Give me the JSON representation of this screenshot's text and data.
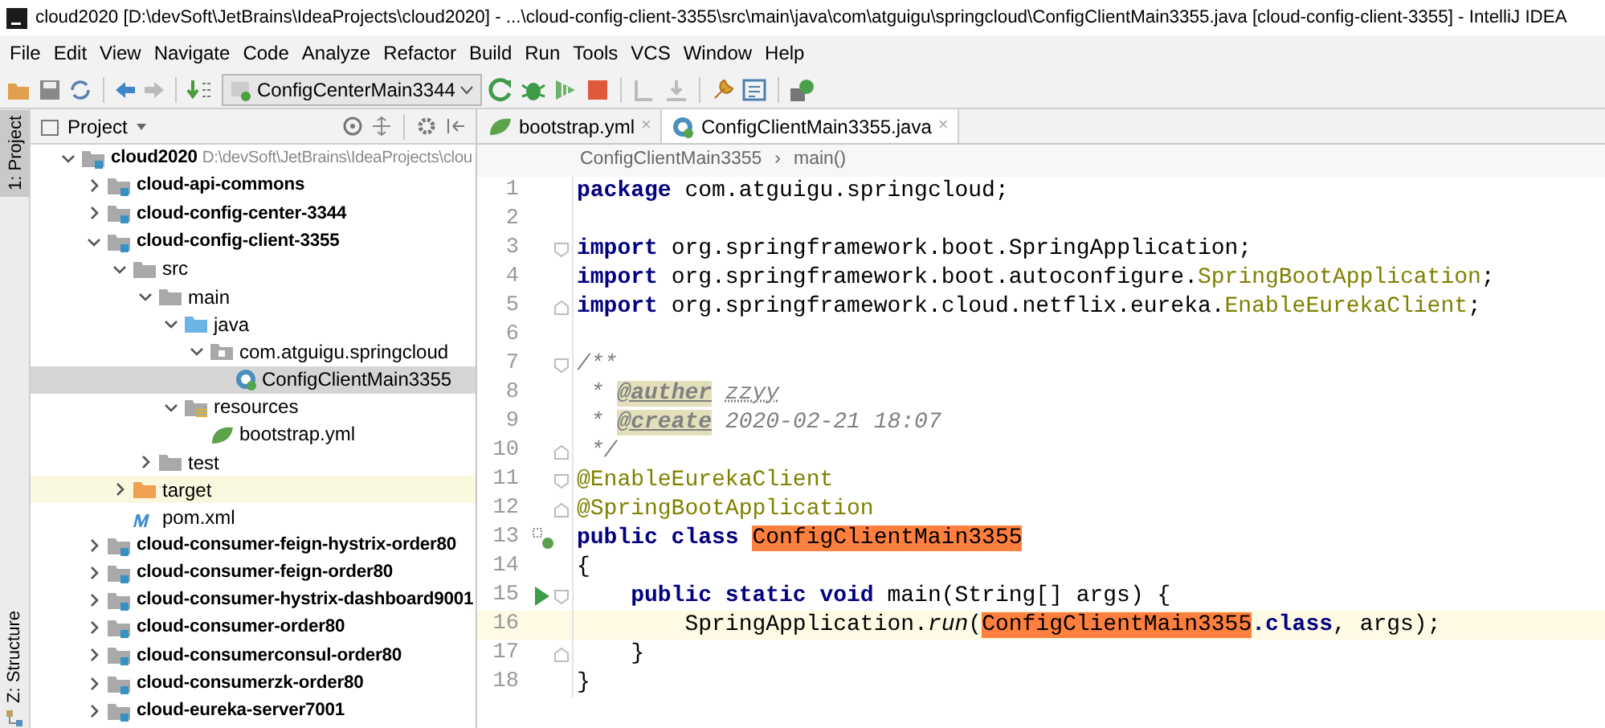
{
  "window": {
    "title": "cloud2020 [D:\\devSoft\\JetBrains\\IdeaProjects\\cloud2020] - ...\\cloud-config-client-3355\\src\\main\\java\\com\\atguigu\\springcloud\\ConfigClientMain3355.java [cloud-config-client-3355] - IntelliJ IDEA"
  },
  "menu": [
    "File",
    "Edit",
    "View",
    "Navigate",
    "Code",
    "Analyze",
    "Refactor",
    "Build",
    "Run",
    "Tools",
    "VCS",
    "Window",
    "Help"
  ],
  "toolbar": {
    "run_config": "ConfigCenterMain3344"
  },
  "side_strip": {
    "top": "1: Project",
    "bottom": "Z: Structure"
  },
  "project": {
    "title": "Project",
    "tree": [
      {
        "label": "cloud2020",
        "path": "D:\\devSoft\\JetBrains\\IdeaProjects\\clou",
        "kind": "module",
        "expanded": true,
        "selected": false,
        "highlighted": false,
        "children": [
          {
            "label": "cloud-api-commons",
            "kind": "module",
            "expanded": false,
            "selected": false,
            "highlighted": false
          },
          {
            "label": "cloud-config-center-3344",
            "kind": "module",
            "expanded": false,
            "selected": false,
            "highlighted": false
          },
          {
            "label": "cloud-config-client-3355",
            "kind": "module",
            "expanded": true,
            "selected": false,
            "highlighted": false,
            "children": [
              {
                "label": "src",
                "kind": "folder",
                "expanded": true,
                "selected": false,
                "highlighted": false,
                "children": [
                  {
                    "label": "main",
                    "kind": "folder",
                    "expanded": true,
                    "selected": false,
                    "highlighted": false,
                    "children": [
                      {
                        "label": "java",
                        "kind": "source",
                        "expanded": true,
                        "selected": false,
                        "highlighted": false,
                        "children": [
                          {
                            "label": "com.atguigu.springcloud",
                            "kind": "package",
                            "expanded": true,
                            "selected": false,
                            "highlighted": false,
                            "children": [
                              {
                                "label": "ConfigClientMain3355",
                                "kind": "class",
                                "selected": true,
                                "highlighted": false
                              }
                            ]
                          }
                        ]
                      },
                      {
                        "label": "resources",
                        "kind": "resources",
                        "expanded": true,
                        "selected": false,
                        "highlighted": false,
                        "children": [
                          {
                            "label": "bootstrap.yml",
                            "kind": "yml",
                            "selected": false,
                            "highlighted": false
                          }
                        ]
                      }
                    ]
                  },
                  {
                    "label": "test",
                    "kind": "folder",
                    "expanded": false,
                    "selected": false,
                    "highlighted": false
                  }
                ]
              },
              {
                "label": "target",
                "kind": "target",
                "expanded": false,
                "selected": false,
                "highlighted": true
              },
              {
                "label": "pom.xml",
                "kind": "maven",
                "selected": false,
                "highlighted": false
              }
            ]
          },
          {
            "label": "cloud-consumer-feign-hystrix-order80",
            "kind": "module",
            "expanded": false,
            "selected": false,
            "highlighted": false
          },
          {
            "label": "cloud-consumer-feign-order80",
            "kind": "module",
            "expanded": false,
            "selected": false,
            "highlighted": false
          },
          {
            "label": "cloud-consumer-hystrix-dashboard9001",
            "kind": "module",
            "expanded": false,
            "selected": false,
            "highlighted": false
          },
          {
            "label": "cloud-consumer-order80",
            "kind": "module",
            "expanded": false,
            "selected": false,
            "highlighted": false
          },
          {
            "label": "cloud-consumerconsul-order80",
            "kind": "module",
            "expanded": false,
            "selected": false,
            "highlighted": false
          },
          {
            "label": "cloud-consumerzk-order80",
            "kind": "module",
            "expanded": false,
            "selected": false,
            "highlighted": false
          },
          {
            "label": "cloud-eureka-server7001",
            "kind": "module",
            "expanded": false,
            "selected": false,
            "highlighted": false
          }
        ]
      }
    ]
  },
  "editor": {
    "tabs": [
      {
        "label": "bootstrap.yml",
        "kind": "yml",
        "close": "×",
        "selected": false
      },
      {
        "label": "ConfigClientMain3355.java",
        "kind": "class",
        "close": "×",
        "selected": true
      }
    ],
    "breadcrumbs": [
      "ConfigClientMain3355",
      "main()"
    ],
    "breadcrumb_separator": "›",
    "lines": [
      {
        "number": "1",
        "current": false,
        "tokens": [
          {
            "text": "package",
            "kind": "keyword"
          },
          {
            "text": " com.atguigu.springcloud;",
            "kind": "plain"
          }
        ]
      },
      {
        "number": "2",
        "current": false
      },
      {
        "number": "3",
        "current": false,
        "fold_start": true,
        "tokens": [
          {
            "text": "import",
            "kind": "keyword"
          },
          {
            "text": " org.springframework.boot.SpringApplication;",
            "kind": "plain"
          }
        ]
      },
      {
        "number": "4",
        "current": false,
        "tokens": [
          {
            "text": "import",
            "kind": "keyword"
          },
          {
            "text": " org.springframework.boot.autoconfigure.",
            "kind": "plain"
          },
          {
            "text": "SpringBootApplication",
            "kind": "annotation"
          },
          {
            "text": ";",
            "kind": "plain"
          }
        ]
      },
      {
        "number": "5",
        "current": false,
        "fold_end": true,
        "tokens": [
          {
            "text": "import",
            "kind": "keyword"
          },
          {
            "text": " org.springframework.cloud.netflix.eureka.",
            "kind": "plain"
          },
          {
            "text": "EnableEurekaClient",
            "kind": "annotation"
          },
          {
            "text": ";",
            "kind": "plain"
          }
        ]
      },
      {
        "number": "6",
        "current": false
      },
      {
        "number": "7",
        "current": false,
        "fold_start": true,
        "tokens": [
          {
            "text": "/**",
            "kind": "comment"
          }
        ]
      },
      {
        "number": "8",
        "current": false,
        "tokens": [
          {
            "text": " * ",
            "kind": "comment"
          },
          {
            "text": "@auther",
            "kind": "doctag"
          },
          {
            "text": "zzyy",
            "kind": "docvalue"
          }
        ]
      },
      {
        "number": "9",
        "current": false,
        "tokens": [
          {
            "text": " * ",
            "kind": "comment"
          },
          {
            "text": "@create",
            "kind": "doctag"
          },
          {
            "text": " 2020-02-21 18:07",
            "kind": "comment"
          }
        ]
      },
      {
        "number": "10",
        "current": false,
        "fold_end": true,
        "tokens": [
          {
            "text": " */",
            "kind": "comment"
          }
        ]
      },
      {
        "number": "11",
        "current": false,
        "fold_start": true,
        "tokens": [
          {
            "text": "@EnableEurekaClient",
            "kind": "annotation"
          }
        ]
      },
      {
        "number": "12",
        "current": false,
        "fold_end": true,
        "tokens": [
          {
            "text": "@SpringBootApplication",
            "kind": "annotation"
          }
        ]
      },
      {
        "number": "13",
        "current": false,
        "class_marker": true,
        "tokens": [
          {
            "text": "public class ",
            "kind": "keyword"
          },
          {
            "text": "ConfigClientMain3355",
            "kind": "highlight"
          }
        ]
      },
      {
        "number": "14",
        "current": false,
        "tokens": [
          {
            "text": "{",
            "kind": "plain"
          }
        ]
      },
      {
        "number": "15",
        "current": false,
        "run_marker": true,
        "fold_start": true,
        "tokens": [
          {
            "text": "    public static void ",
            "kind": "keyword"
          },
          {
            "text": "main(String[] args) {",
            "kind": "plain"
          }
        ]
      },
      {
        "number": "16",
        "current": true,
        "tokens": [
          {
            "text": "        SpringApplication.",
            "kind": "plain"
          },
          {
            "text": "run",
            "kind": "italic"
          },
          {
            "text": "(",
            "kind": "plain"
          },
          {
            "text": "ConfigClientMain3355",
            "kind": "highlight"
          },
          {
            "text": ".class",
            "kind": "keyword"
          },
          {
            "text": ", args);",
            "kind": "plain"
          }
        ]
      },
      {
        "number": "17",
        "current": false,
        "fold_end": true,
        "tokens": [
          {
            "text": "    }",
            "kind": "plain"
          }
        ]
      },
      {
        "number": "18",
        "current": false,
        "tokens": [
          {
            "text": "}",
            "kind": "plain"
          }
        ]
      }
    ]
  }
}
